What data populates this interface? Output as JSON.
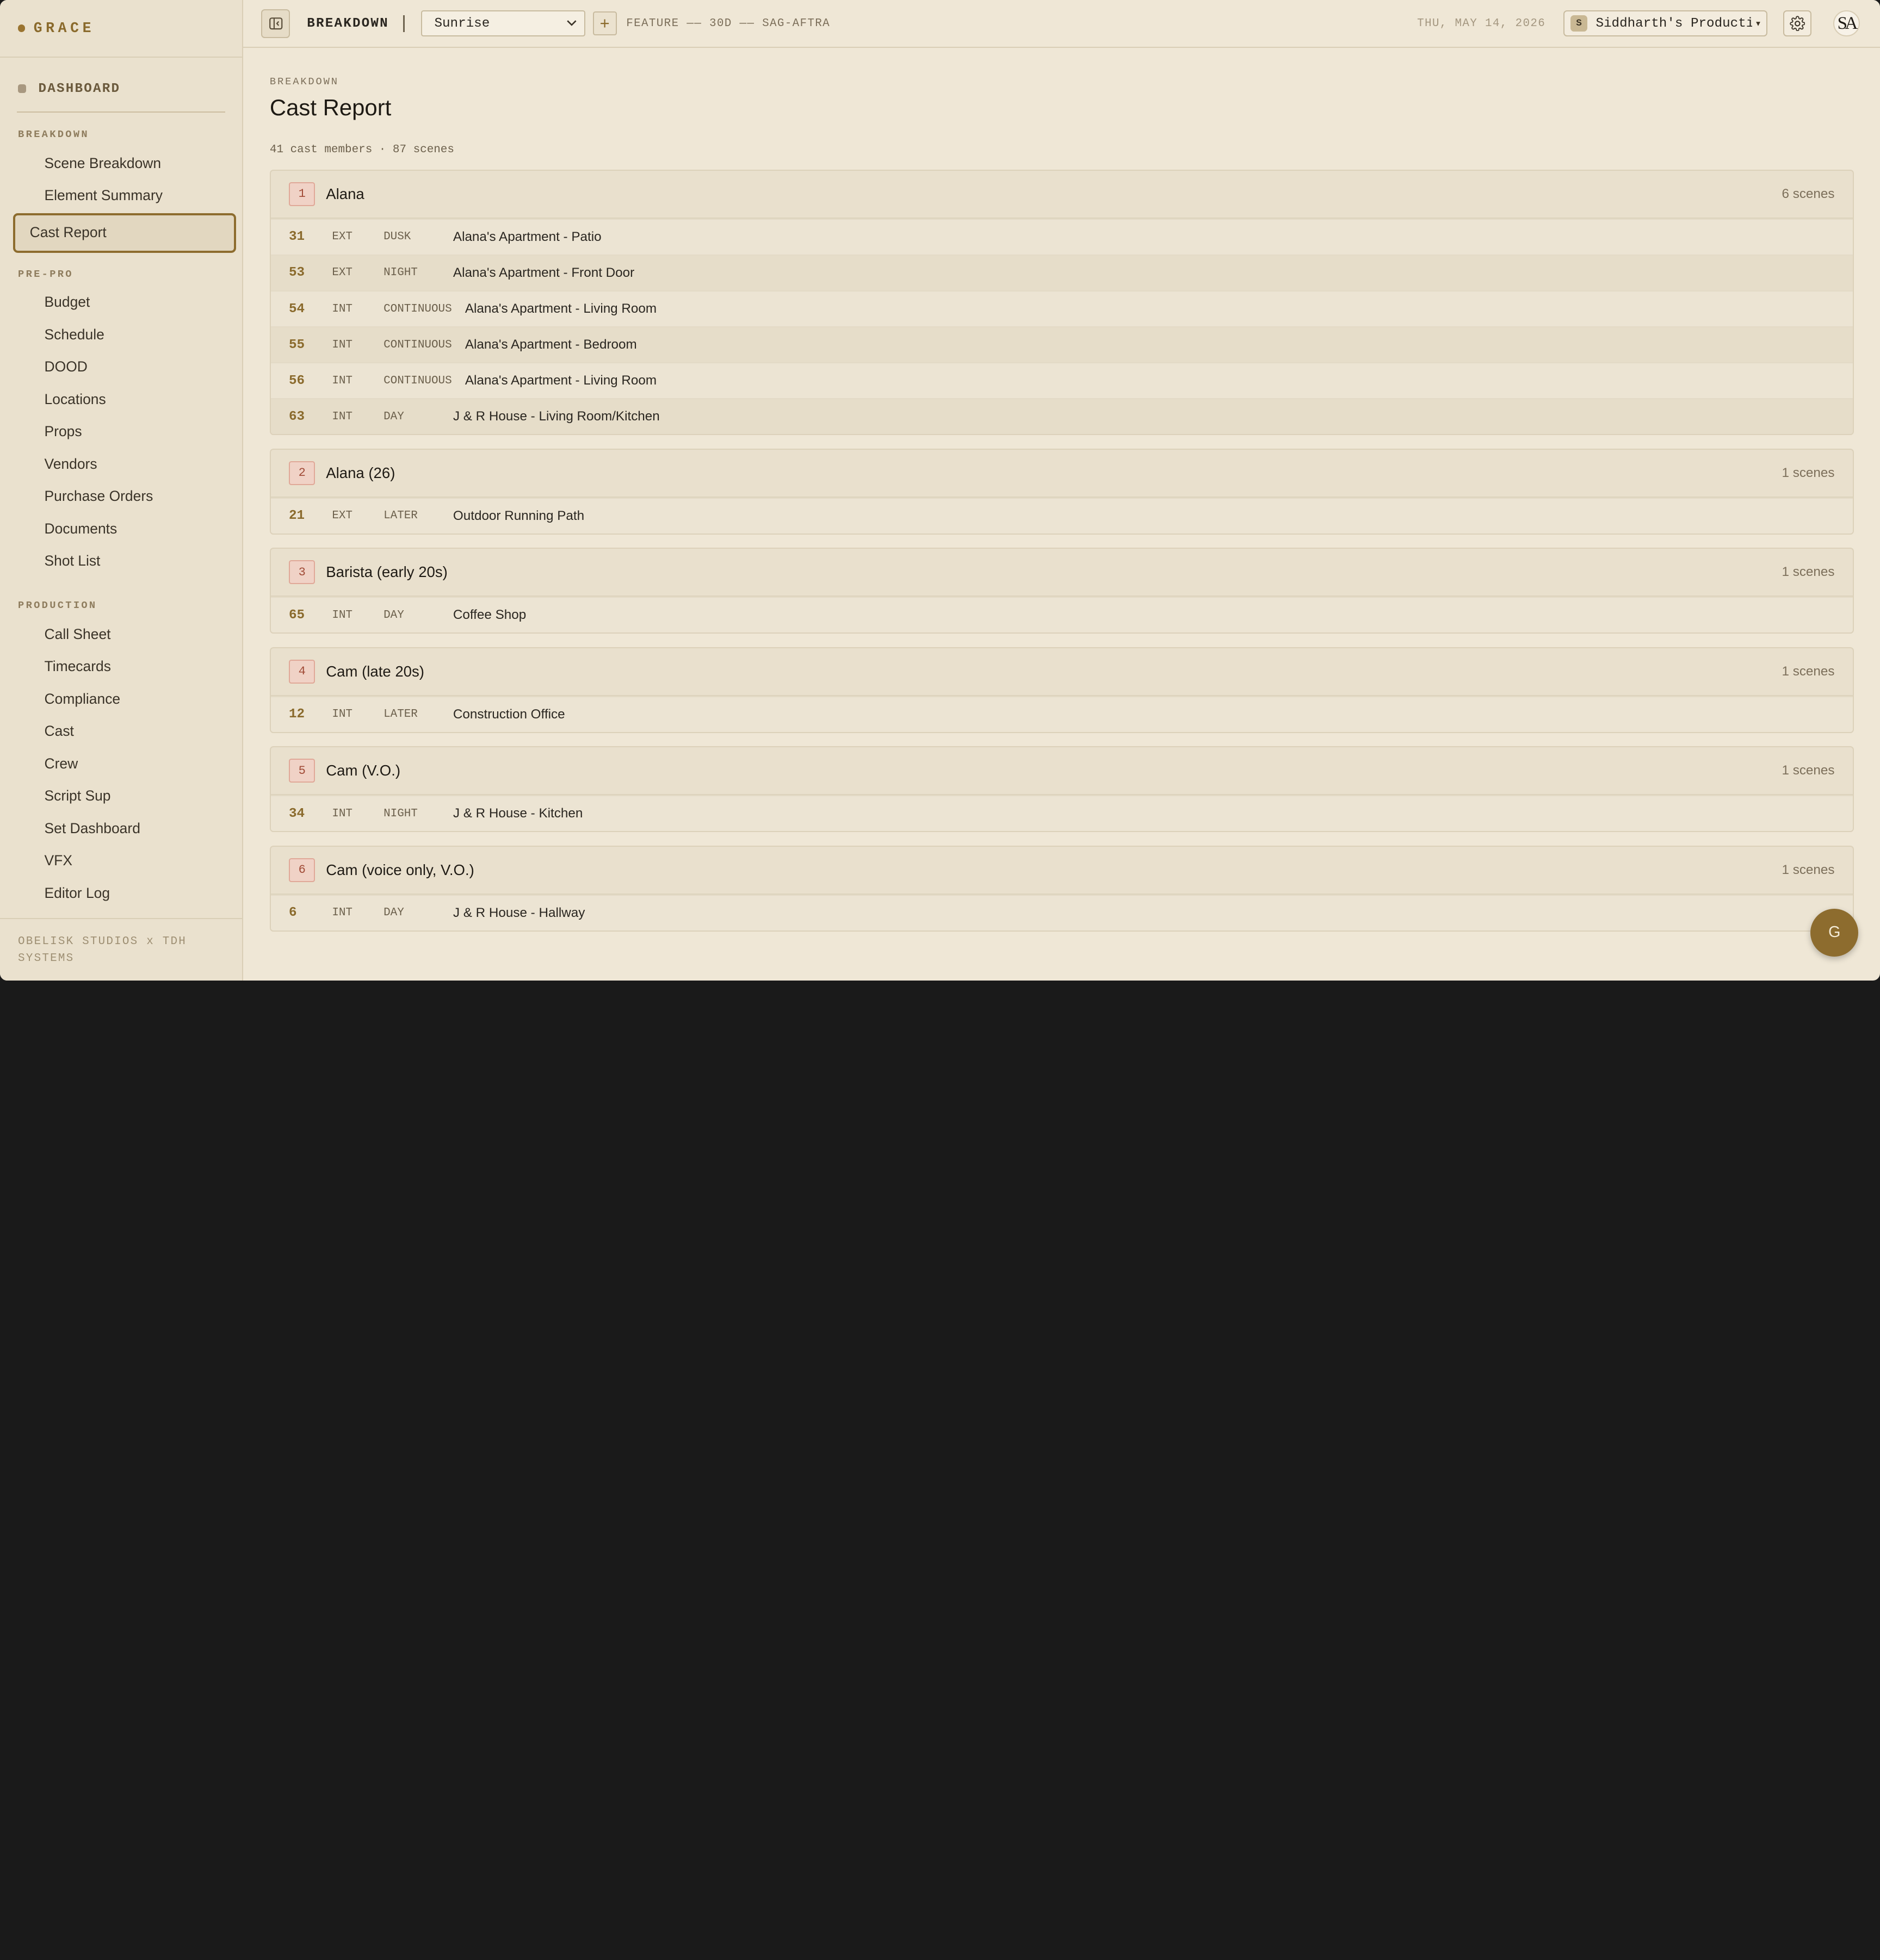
{
  "app": {
    "brand": "GRACE",
    "footer": "OBELISK STUDIOS x TDH SYSTEMS",
    "accent": "#8d6c2e"
  },
  "sidebar": {
    "dashboard": "DASHBOARD",
    "sections": [
      {
        "label": "BREAKDOWN",
        "items": [
          "Scene Breakdown",
          "Element Summary",
          "Cast Report"
        ]
      },
      {
        "label": "PRE-PRO",
        "items": [
          "Budget",
          "Schedule",
          "DOOD",
          "Locations",
          "Props",
          "Vendors",
          "Purchase Orders",
          "Documents",
          "Shot List"
        ]
      },
      {
        "label": "PRODUCTION",
        "items": [
          "Call Sheet",
          "Timecards",
          "Compliance",
          "Cast",
          "Crew",
          "Script Sup",
          "Set Dashboard",
          "VFX",
          "Editor Log"
        ]
      }
    ],
    "active_item": "Cast Report"
  },
  "topbar": {
    "title": "BREAKDOWN",
    "project": "Sunrise",
    "add_label": "+",
    "meta": "FEATURE —— 30D —— SAG-AFTRA",
    "date": "THU, MAY 14, 2026",
    "org_initial": "S",
    "org_name": "Siddharth's Producti…",
    "org_caret": "▾",
    "avatar": "SA"
  },
  "main": {
    "breadcrumb": "BREAKDOWN",
    "title": "Cast Report",
    "summary": "41 cast members · 87 scenes",
    "cast": [
      {
        "num": "1",
        "name": "Alana",
        "count": "6 scenes",
        "scenes": [
          {
            "scene": "31",
            "ie": "EXT",
            "tod": "DUSK",
            "loc": "Alana's Apartment - Patio"
          },
          {
            "scene": "53",
            "ie": "EXT",
            "tod": "NIGHT",
            "loc": "Alana's Apartment - Front Door"
          },
          {
            "scene": "54",
            "ie": "INT",
            "tod": "CONTINUOUS",
            "loc": "Alana's Apartment - Living Room"
          },
          {
            "scene": "55",
            "ie": "INT",
            "tod": "CONTINUOUS",
            "loc": "Alana's Apartment - Bedroom"
          },
          {
            "scene": "56",
            "ie": "INT",
            "tod": "CONTINUOUS",
            "loc": "Alana's Apartment - Living Room"
          },
          {
            "scene": "63",
            "ie": "INT",
            "tod": "DAY",
            "loc": "J & R House - Living Room/Kitchen"
          }
        ]
      },
      {
        "num": "2",
        "name": "Alana (26)",
        "count": "1 scenes",
        "scenes": [
          {
            "scene": "21",
            "ie": "EXT",
            "tod": "LATER",
            "loc": "Outdoor Running Path"
          }
        ]
      },
      {
        "num": "3",
        "name": "Barista (early 20s)",
        "count": "1 scenes",
        "scenes": [
          {
            "scene": "65",
            "ie": "INT",
            "tod": "DAY",
            "loc": "Coffee Shop"
          }
        ]
      },
      {
        "num": "4",
        "name": "Cam (late 20s)",
        "count": "1 scenes",
        "scenes": [
          {
            "scene": "12",
            "ie": "INT",
            "tod": "LATER",
            "loc": "Construction Office"
          }
        ]
      },
      {
        "num": "5",
        "name": "Cam (V.O.)",
        "count": "1 scenes",
        "scenes": [
          {
            "scene": "34",
            "ie": "INT",
            "tod": "NIGHT",
            "loc": "J & R House - Kitchen"
          }
        ]
      },
      {
        "num": "6",
        "name": "Cam (voice only, V.O.)",
        "count": "1 scenes",
        "scenes": [
          {
            "scene": "6",
            "ie": "INT",
            "tod": "DAY",
            "loc": "J & R House - Hallway"
          }
        ]
      }
    ]
  },
  "fab": {
    "label": "G"
  }
}
